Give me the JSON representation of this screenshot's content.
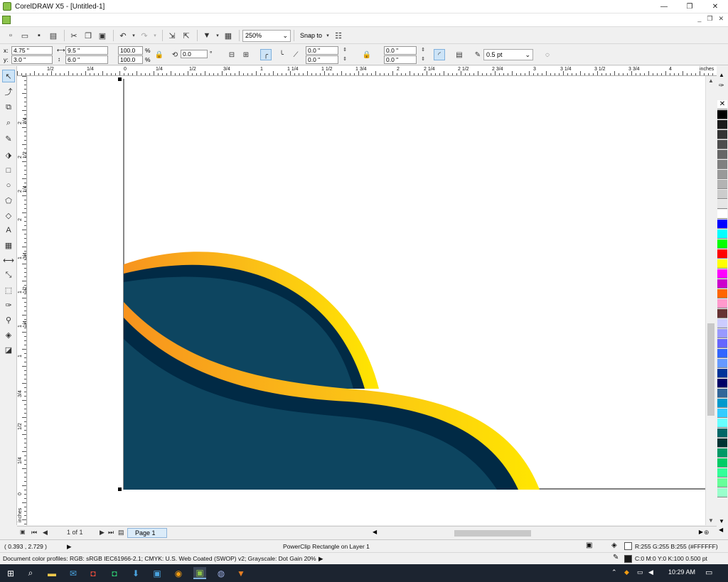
{
  "window": {
    "title": "CorelDRAW X5 - [Untitled-1]",
    "minimize_glyph": "—",
    "restore_glyph": "❐",
    "close_glyph": "✕",
    "mdi_minimize": "_",
    "mdi_restore": "❐",
    "mdi_close": "✕"
  },
  "toolbar": {
    "zoom_value": "250%",
    "snap_label": "Snap to",
    "icons": [
      "new-icon",
      "open-icon",
      "save-icon",
      "print-icon",
      "cut-icon",
      "copy-icon",
      "paste-icon",
      "undo-icon",
      "redo-icon",
      "import-icon",
      "export-icon",
      "app-launcher-icon",
      "welcome-screen-icon",
      "options-icon"
    ]
  },
  "property_bar": {
    "x_label": "x:",
    "x_value": "4.75 \"",
    "y_label": "y:",
    "y_value": "3.0 \"",
    "width_value": "9.5 \"",
    "height_value": "6.0 \"",
    "scale_x": "100.0",
    "scale_y": "100.0",
    "percent": "%",
    "rotation": "0.0",
    "degree": "°",
    "corner_tl": "0.0 \"",
    "corner_bl": "0.0 \"",
    "corner_tr": "0.0 \"",
    "corner_br": "0.0 \"",
    "outline_width": "0.5 pt"
  },
  "hruler": {
    "labels": [
      {
        "t": "1/2",
        "p": 42
      },
      {
        "t": "1/4",
        "p": 98
      },
      {
        "t": "0",
        "p": 150
      },
      {
        "t": "1/4",
        "p": 195
      },
      {
        "t": "1/2",
        "p": 242
      },
      {
        "t": "3/4",
        "p": 290
      },
      {
        "t": "1",
        "p": 342
      },
      {
        "t": "1 1/4",
        "p": 380
      },
      {
        "t": "1 1/2",
        "p": 428
      },
      {
        "t": "1 3/4",
        "p": 476
      },
      {
        "t": "2",
        "p": 534
      },
      {
        "t": "2 1/4",
        "p": 572
      },
      {
        "t": "2 1/2",
        "p": 620
      },
      {
        "t": "2 3/4",
        "p": 668
      },
      {
        "t": "3",
        "p": 726
      },
      {
        "t": "3 1/4",
        "p": 764
      },
      {
        "t": "3 1/2",
        "p": 812
      },
      {
        "t": "3 3/4",
        "p": 860
      },
      {
        "t": "4",
        "p": 917
      }
    ],
    "unit": "inches"
  },
  "vruler": {
    "labels": [
      {
        "t": "2 3/4",
        "p": 60
      },
      {
        "t": "2 1/2",
        "p": 108
      },
      {
        "t": "2 1/4",
        "p": 156
      },
      {
        "t": "2",
        "p": 196
      },
      {
        "t": "1 3/4",
        "p": 250
      },
      {
        "t": "1 1/2",
        "p": 298
      },
      {
        "t": "1 1/4",
        "p": 346
      },
      {
        "t": "1",
        "p": 388
      },
      {
        "t": "3/4",
        "p": 444
      },
      {
        "t": "1/2",
        "p": 490
      },
      {
        "t": "1/4",
        "p": 538
      },
      {
        "t": "0",
        "p": 582
      }
    ],
    "unit": "inches"
  },
  "tools": [
    "pick-tool-icon",
    "shape-tool-icon",
    "crop-tool-icon",
    "zoom-tool-icon",
    "freehand-tool-icon",
    "smart-fill-tool-icon",
    "rectangle-tool-icon",
    "ellipse-tool-icon",
    "polygon-tool-icon",
    "basic-shapes-tool-icon",
    "text-tool-icon",
    "table-tool-icon",
    "dimension-tool-icon",
    "connector-tool-icon",
    "blend-tool-icon",
    "eyedropper-tool-icon",
    "outline-tool-icon",
    "fill-tool-icon",
    "interactive-fill-tool-icon"
  ],
  "palette": {
    "none_glyph": "✕",
    "colors": [
      "#000000",
      "#1a1a1a",
      "#333333",
      "#4d4d4d",
      "#666666",
      "#808080",
      "#999999",
      "#b3b3b3",
      "#cccccc",
      "#e6e6e6",
      "#ffffff",
      "#0000ff",
      "#00ffff",
      "#00ff00",
      "#ff0000",
      "#ffff00",
      "#ff00ff",
      "#cc00cc",
      "#ff6600",
      "#ff99cc",
      "#663333",
      "#ccccff",
      "#9999ff",
      "#6666ff",
      "#3366ff",
      "#6699ff",
      "#003399",
      "#000066",
      "#336699",
      "#0099cc",
      "#33ccff",
      "#66ffff",
      "#006666",
      "#003333",
      "#009966",
      "#00cc66",
      "#33ff99",
      "#66ff99",
      "#99ffcc"
    ]
  },
  "page_nav": {
    "page_count": "1 of 1",
    "page_tab": "Page 1"
  },
  "status": {
    "coords": "( 0.393 , 2.729 )",
    "object_info": "PowerClip Rectangle on Layer 1",
    "fill_info": "R:255 G:255 B:255 (#FFFFFF)",
    "outline_info": "C:0 M:0 Y:0 K:100  0.500 pt",
    "color_profiles": "Document color profiles: RGB: sRGB IEC61966-2.1; CMYK: U.S. Web Coated (SWOP) v2; Grayscale: Dot Gain 20%",
    "arrow": "▶"
  },
  "taskbar": {
    "time": "10:29 AM"
  },
  "colors": {
    "navy": "#0d4560",
    "dark_navy": "#012a45",
    "orange": "#f7931e",
    "yellow": "#ffe100"
  }
}
